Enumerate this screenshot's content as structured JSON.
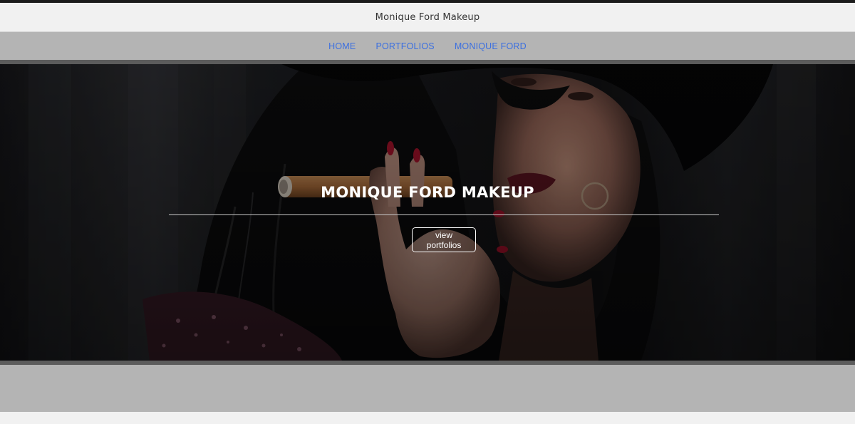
{
  "header": {
    "site_title": "Monique Ford Makeup"
  },
  "nav": {
    "items": [
      {
        "label": "HOME"
      },
      {
        "label": "PORTFOLIOS"
      },
      {
        "label": "MONIQUE FORD"
      }
    ],
    "link_color": "#3b6fe0",
    "background": "#b4b4b4"
  },
  "hero": {
    "title": "MONIQUE FORD MAKEUP",
    "button_label": "view portfolios",
    "image": "portrait-photo"
  },
  "colors": {
    "page_background": "#f1f1f1",
    "band_gray": "#b4b4b4",
    "hero_border": "#5c5c5c"
  }
}
